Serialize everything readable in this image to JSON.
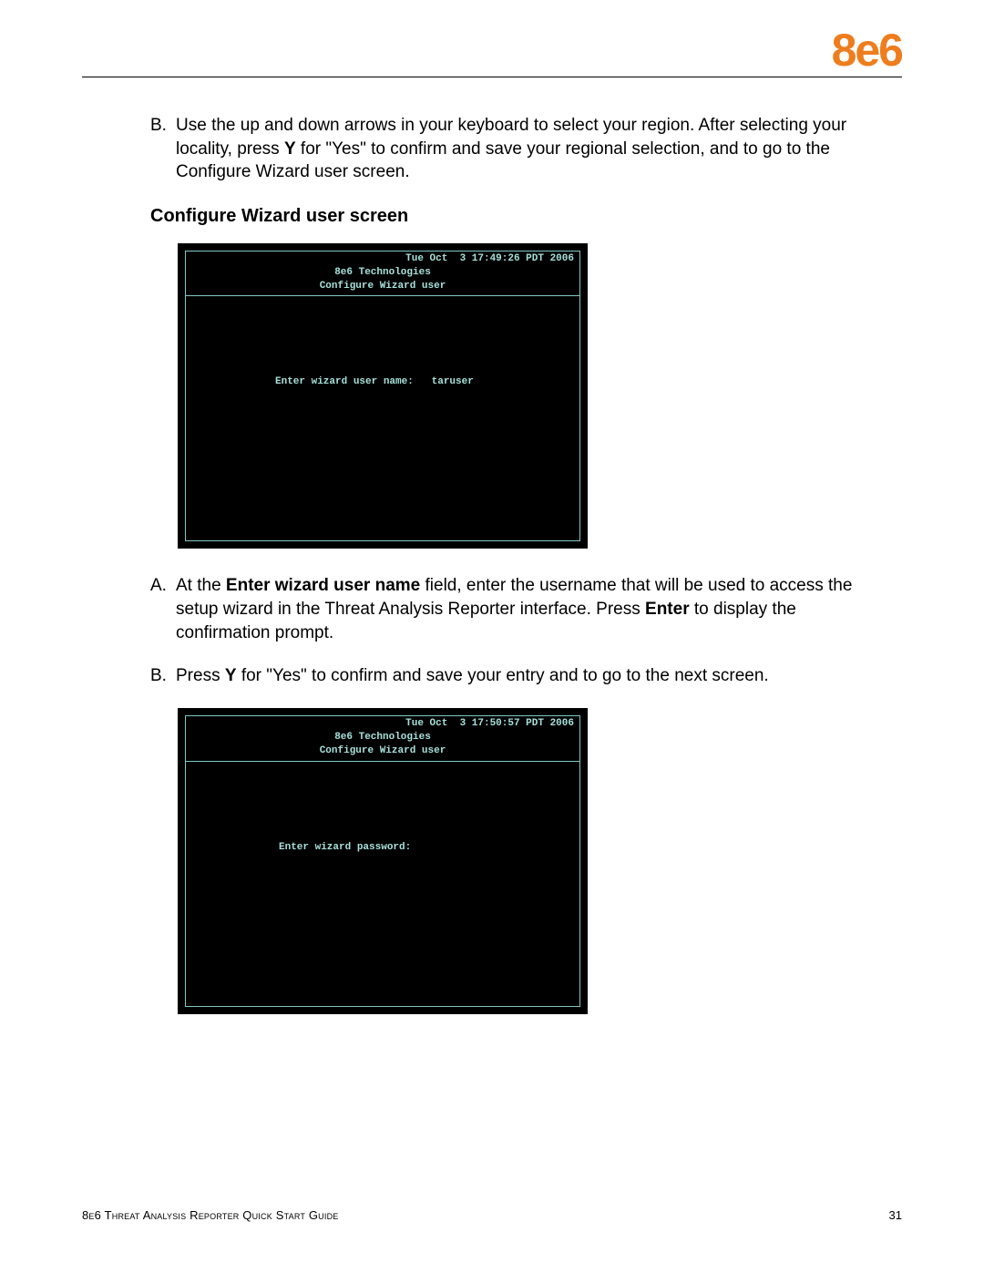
{
  "header": {
    "logo_text": "8e6"
  },
  "intro_list": {
    "marker_b": "B.",
    "text_b_before": "Use the up and down arrows in your keyboard to select your region. After selecting your locality, press ",
    "text_b_bold1": "Y",
    "text_b_mid": " for \"Yes\" to confirm and save your regional selection, and to go to the Configure Wizard user screen."
  },
  "section_heading": "Configure Wizard user screen",
  "terminal1": {
    "date": "Tue Oct  3 17:49:26 PDT 2006",
    "company": "8e6 Technologies",
    "subtitle": "Configure Wizard user",
    "prompt_label": "Enter wizard user name:",
    "prompt_value": "   taruser"
  },
  "list2": {
    "marker_a": "A.",
    "a_t1": "At the ",
    "a_b1": "Enter wizard user name",
    "a_t2": " field, enter the username that will be used to access the setup wizard in the Threat Analysis Reporter interface. Press ",
    "a_b2": "Enter",
    "a_t3": " to display the confirmation prompt.",
    "marker_b": "B.",
    "b_t1": "Press ",
    "b_b1": "Y",
    "b_t2": " for \"Yes\" to confirm and save your entry and to go to the next screen."
  },
  "terminal2": {
    "date": "Tue Oct  3 17:50:57 PDT 2006",
    "company": "8e6 Technologies",
    "subtitle": "Configure Wizard user",
    "prompt_label": "Enter wizard password:",
    "prompt_value": ""
  },
  "footer": {
    "left": "8e6 Threat Analysis Reporter Quick Start Guide",
    "right": "31"
  }
}
